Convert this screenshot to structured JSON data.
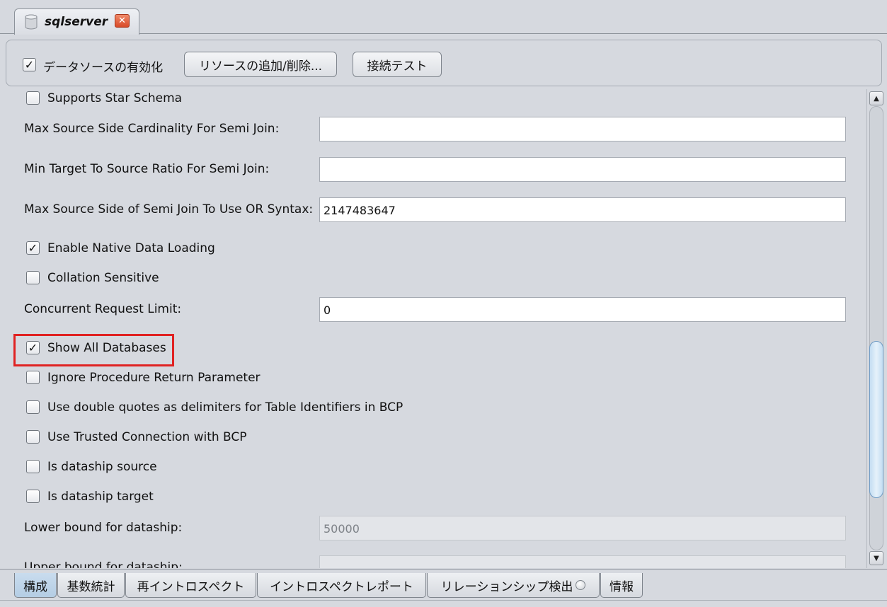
{
  "tab": {
    "title": "sqlserver",
    "close_glyph": "✕",
    "icon": "database-icon"
  },
  "toolbar": {
    "enable_datasource": {
      "label": "データソースの有効化",
      "checked": true
    },
    "add_remove_resources": "リソースの追加/削除...",
    "connection_test": "接続テスト"
  },
  "settings": {
    "supports_star_schema": {
      "label": "Supports Star Schema",
      "checked": false
    },
    "max_source_side_cardinality": {
      "label": "Max Source Side Cardinality For Semi Join:",
      "value": ""
    },
    "min_target_to_source_ratio": {
      "label": "Min Target To Source Ratio For Semi Join:",
      "value": ""
    },
    "max_source_side_or_syntax": {
      "label": "Max Source Side of Semi Join To Use OR Syntax:",
      "value": "2147483647"
    },
    "enable_native_data_loading": {
      "label": "Enable Native Data Loading",
      "checked": true
    },
    "collation_sensitive": {
      "label": "Collation Sensitive",
      "checked": false
    },
    "concurrent_request_limit": {
      "label": "Concurrent Request Limit:",
      "value": "0"
    },
    "show_all_databases": {
      "label": "Show All Databases",
      "checked": true
    },
    "ignore_procedure_return": {
      "label": "Ignore Procedure Return Parameter",
      "checked": false
    },
    "double_quotes_bcp": {
      "label": "Use double quotes as delimiters for Table Identifiers in BCP",
      "checked": false
    },
    "trusted_connection_bcp": {
      "label": "Use Trusted Connection with BCP",
      "checked": false
    },
    "is_dataship_source": {
      "label": "Is dataship source",
      "checked": false
    },
    "is_dataship_target": {
      "label": "Is dataship target",
      "checked": false
    },
    "lower_bound_dataship": {
      "label": "Lower bound for dataship:",
      "value": "50000"
    },
    "upper_bound_dataship": {
      "label": "Upper bound for dataship:",
      "value": ""
    }
  },
  "check_glyph": "✓",
  "scrollbar": {
    "up": "▲",
    "down": "▼"
  },
  "bottom_tabs": [
    "構成",
    "基数統計",
    "再イントロスペクト",
    "イントロスペクトレポート",
    "リレーションシップ検出",
    "情報"
  ],
  "colors": {
    "highlight": "#e02222",
    "background": "#d6d9df",
    "active_tab": "#b4cde4"
  }
}
